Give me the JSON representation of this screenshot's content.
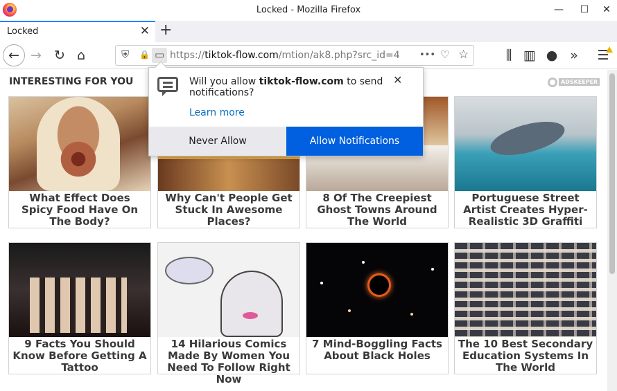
{
  "window": {
    "title": "Locked - Mozilla Firefox",
    "minimize": "—",
    "maximize": "☐",
    "close": "✕"
  },
  "tab": {
    "title": "Locked",
    "close": "✕",
    "new_tab": "+"
  },
  "nav": {
    "back": "←",
    "forward": "→",
    "reload": "↻",
    "home": "⌂",
    "url_prefix": "https://",
    "url_host": "tiktok-flow.com",
    "url_path": "/mtion/ak8.php?src_id=4",
    "more": "•••",
    "pocket": "♡",
    "bookmark": "☆",
    "library": "⫼",
    "sidebar": "▥",
    "sync": "●",
    "overflow": "»",
    "menu": "☰",
    "shield": "⛨",
    "lock": "🔒",
    "permission": "▭"
  },
  "page": {
    "heading": "INTERESTING FOR YOU",
    "sponsor": "ADSKEEPER",
    "cards": [
      {
        "caption": "What Effect Does Spicy Food Have On The Body?"
      },
      {
        "caption": "Why Can't People Get Stuck In Awesome Places?"
      },
      {
        "caption": "8 Of The Creepiest Ghost Towns Around The World"
      },
      {
        "caption": "Portuguese Street Artist Creates Hyper-Realistic 3D Graffiti"
      },
      {
        "caption": "9 Facts You Should Know Before Getting A Tattoo"
      },
      {
        "caption": "14 Hilarious Comics Made By Women You Need To Follow Right Now"
      },
      {
        "caption": "7 Mind-Boggling Facts About Black Holes"
      },
      {
        "caption": "The 10 Best Secondary Education Systems In The World"
      }
    ]
  },
  "popup": {
    "text_before": "Will you allow ",
    "site": "tiktok-flow.com",
    "text_after": " to send notifications?",
    "close": "✕",
    "learn_more": "Learn more",
    "never_allow": "Never Allow",
    "allow": "Allow Notifications"
  }
}
